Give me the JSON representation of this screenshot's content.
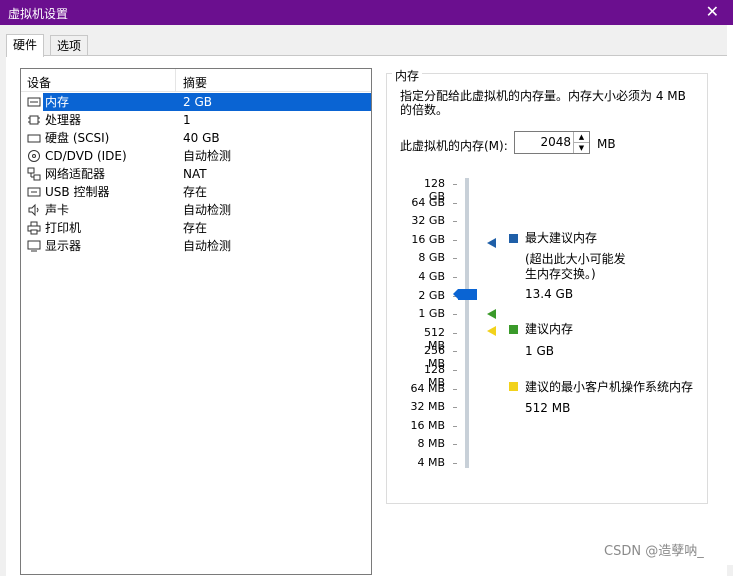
{
  "window": {
    "title": "虚拟机设置",
    "close_glyph": "✕"
  },
  "tabs": [
    {
      "label": "硬件"
    },
    {
      "label": "选项"
    }
  ],
  "device_list": {
    "headers": {
      "device": "设备",
      "summary": "摘要"
    },
    "rows": [
      {
        "icon": "memory-icon",
        "name": "内存",
        "summary": "2 GB"
      },
      {
        "icon": "processor-icon",
        "name": "处理器",
        "summary": "1"
      },
      {
        "icon": "disk-icon",
        "name": "硬盘 (SCSI)",
        "summary": "40 GB"
      },
      {
        "icon": "cd-dvd-icon",
        "name": "CD/DVD (IDE)",
        "summary": "自动检测"
      },
      {
        "icon": "network-icon",
        "name": "网络适配器",
        "summary": "NAT"
      },
      {
        "icon": "usb-icon",
        "name": "USB 控制器",
        "summary": "存在"
      },
      {
        "icon": "sound-icon",
        "name": "声卡",
        "summary": "自动检测"
      },
      {
        "icon": "printer-icon",
        "name": "打印机",
        "summary": "存在"
      },
      {
        "icon": "display-icon",
        "name": "显示器",
        "summary": "自动检测"
      }
    ]
  },
  "memory": {
    "group_title": "内存",
    "description": "指定分配给此虚拟机的内存量。内存大小必须为 4 MB 的倍数。",
    "field_label": "此虚拟机的内存(M):",
    "value": "2048",
    "unit": "MB",
    "scale_ticks": [
      "128 GB",
      "64 GB",
      "32 GB",
      "16 GB",
      "8 GB",
      "4 GB",
      "2 GB",
      "1 GB",
      "512 MB",
      "256 MB",
      "128 MB",
      "64 MB",
      "32 MB",
      "16 MB",
      "8 MB",
      "4 MB"
    ],
    "slider_value": "2 GB",
    "legend": [
      {
        "color": "#1f5fa8",
        "title": "最大建议内存",
        "note": "(超出此大小可能发生内存交换。)",
        "value": "13.4 GB"
      },
      {
        "color": "#3a9a2a",
        "title": "建议内存",
        "value": "1 GB"
      },
      {
        "color": "#f2d21b",
        "title": "建议的最小客户机操作系统内存",
        "value": "512 MB"
      }
    ]
  },
  "watermark": "CSDN @造孽呐_"
}
